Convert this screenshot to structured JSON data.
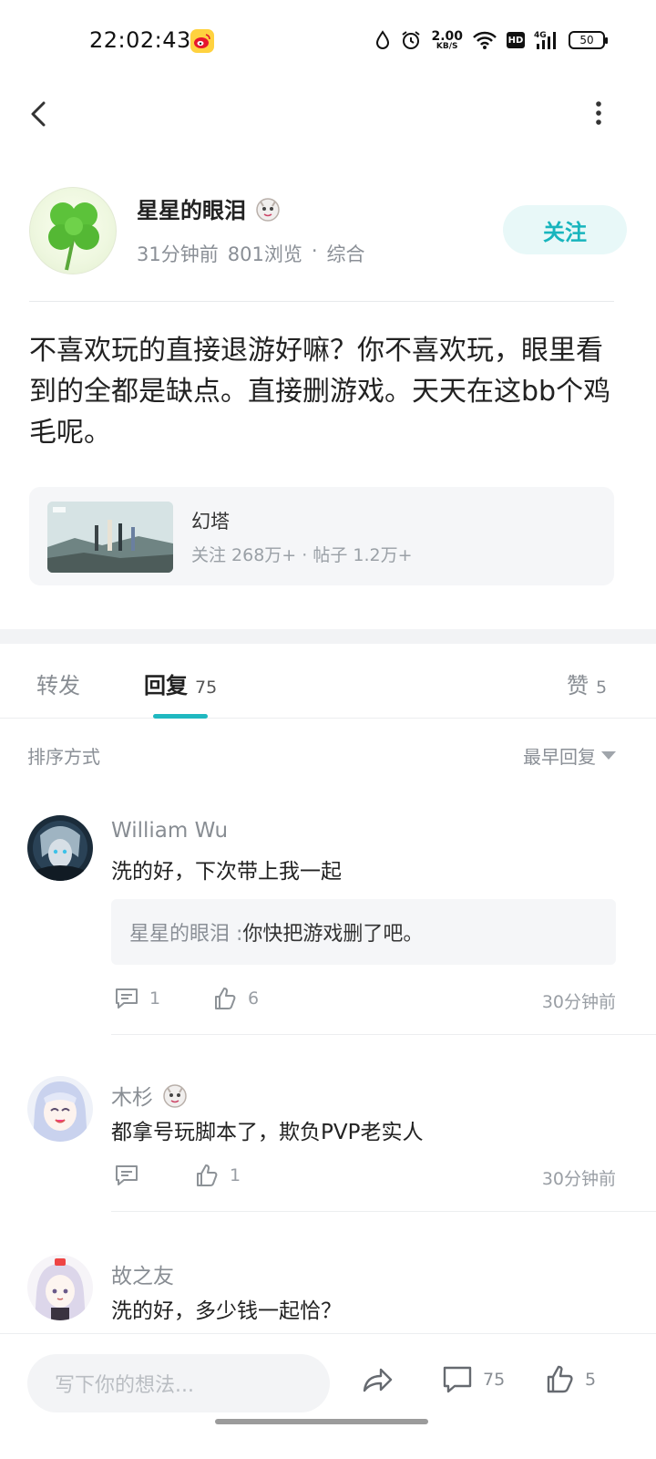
{
  "status_bar": {
    "time": "22:02:43",
    "net_speed_value": "2.00",
    "net_speed_unit": "KB/S",
    "hd": "HD",
    "signal_label": "4G",
    "battery": "50"
  },
  "author": {
    "name": "星星的眼泪",
    "time_ago": "31分钟前",
    "views": "801浏览",
    "separator": "·",
    "category": "综合",
    "follow_label": "关注"
  },
  "post": {
    "text": "不喜欢玩的直接退游好嘛？你不喜欢玩，眼里看到的全都是缺点。直接删游戏。天天在这bb个鸡毛呢。"
  },
  "topic": {
    "name": "幻塔",
    "stats": "关注 268万+ · 帖子 1.2万+"
  },
  "tabs": [
    {
      "label": "转发",
      "count": ""
    },
    {
      "label": "回复",
      "count": "75"
    },
    {
      "label": "赞",
      "count": "5"
    }
  ],
  "sort": {
    "label": "排序方式",
    "value": "最早回复"
  },
  "comments": [
    {
      "name": "William Wu",
      "text": "洗的好，下次带上我一起",
      "quote_author": "星星的眼泪 : ",
      "quote_text": "你快把游戏删了吧。",
      "reply_count": "1",
      "like_count": "6",
      "time": "30分钟前"
    },
    {
      "name": "木杉",
      "text": "都拿号玩脚本了，欺负PVP老实人",
      "reply_count": "",
      "like_count": "1",
      "time": "30分钟前"
    },
    {
      "name": "故之友",
      "text": "洗的好，多少钱一起恰？"
    }
  ],
  "bottom_bar": {
    "placeholder": "写下你的想法...",
    "comment_count": "75",
    "like_count": "5"
  },
  "colors": {
    "accent": "#1fb8c0",
    "follow_bg": "#e8f8f8",
    "muted_text": "#8a8f96"
  }
}
